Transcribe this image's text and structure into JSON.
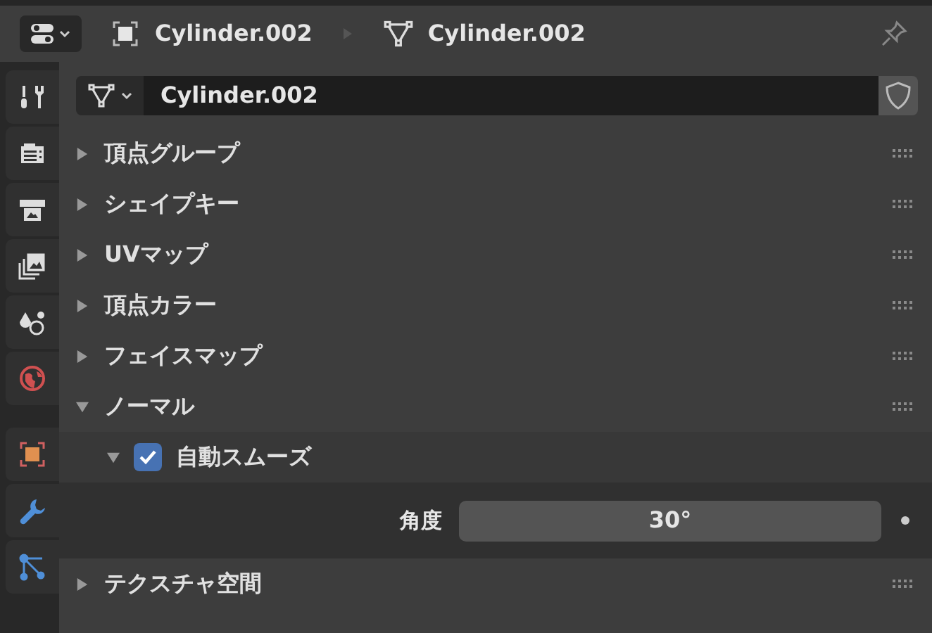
{
  "header": {
    "object_name": "Cylinder.002",
    "data_name": "Cylinder.002"
  },
  "datablock": {
    "value": "Cylinder.002",
    "fake_user": false
  },
  "sidebar_tabs": [
    {
      "kind": "tool",
      "selected": false
    },
    {
      "kind": "render",
      "selected": false
    },
    {
      "kind": "output",
      "selected": false
    },
    {
      "kind": "viewlayer",
      "selected": false
    },
    {
      "kind": "scene",
      "selected": false
    },
    {
      "kind": "world",
      "selected": false
    },
    {
      "kind": "object",
      "selected": false
    },
    {
      "kind": "modifier",
      "selected": false
    },
    {
      "kind": "particles",
      "selected": false
    }
  ],
  "panels": [
    {
      "label": "頂点グループ",
      "expanded": false
    },
    {
      "label": "シェイプキー",
      "expanded": false
    },
    {
      "label": "UVマップ",
      "expanded": false
    },
    {
      "label": "頂点カラー",
      "expanded": false
    },
    {
      "label": "フェイスマップ",
      "expanded": false
    },
    {
      "label": "ノーマル",
      "expanded": true,
      "subpanels": [
        {
          "label": "自動スムーズ",
          "expanded": true,
          "checked": true,
          "properties": [
            {
              "label": "角度",
              "value": "30°"
            }
          ]
        }
      ]
    },
    {
      "label": "テクスチャ空間",
      "expanded": false
    }
  ]
}
